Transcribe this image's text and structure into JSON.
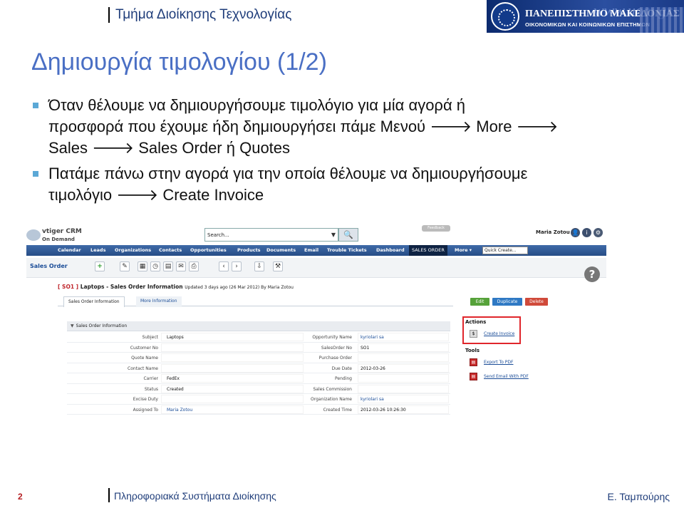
{
  "header": {
    "dept_title": "Τμήμα Διοίκησης Τεχνολογίας",
    "banner": {
      "url": "www.uom.gr",
      "university": "ΠΑΝΕΠΙΣΤΗΜΙΟ ΜΑΚΕΔΟΝΙΑΣ",
      "subtitle": "ΟΙΚΟΝΟΜΙΚΩΝ ΚΑΙ ΚΟΙΝΩΝΙΚΩΝ ΕΠΙΣΤΗΜΩΝ"
    }
  },
  "slide": {
    "title": "Δημιουργία τιμολογίου (1/2)",
    "bullets": [
      {
        "lines": [
          "Όταν θέλουμε να δημιουργήσουμε τιμολόγιο για μία αγορά ή",
          "προσφορά που έχουμε ήδη δημιουργήσει πάμε Μενού 🡒 More 🡒",
          "Sales 🡒 Sales Order ή Quotes"
        ]
      },
      {
        "lines": [
          "Πατάμε πάνω στην αγορά για την οποία θέλουμε να δημιουργήσουμε",
          "τιμολόγιο 🡒 Create Invoice"
        ]
      }
    ]
  },
  "crm": {
    "logo_line1": "vtiger CRM",
    "logo_line2": "On Demand",
    "search_placeholder": "Search...",
    "search_icon": "magnifier-icon",
    "feedback_label": "Feedback",
    "user_name": "Maria Zotou",
    "nav": [
      "Calendar",
      "Leads",
      "Organizations",
      "Contacts",
      "Opportunities",
      "Products",
      "Documents",
      "Email",
      "Trouble Tickets",
      "Dashboard",
      "SALES ORDER",
      "More ▾"
    ],
    "quick_create": "Quick Create...",
    "module_title": "Sales Order",
    "help_icon": "?",
    "record_id": "[ SO1 ]",
    "record_title": "Laptops - Sales Order Information",
    "record_updated": "Updated 3 days ago (26 Mar 2012) By Maria Zotou",
    "tabs": [
      "Sales Order Information",
      "More Information"
    ],
    "buttons": {
      "edit": "Edit",
      "duplicate": "Duplicate",
      "delete": "Delete"
    },
    "section_title": "Sales Order Information",
    "fields": [
      {
        "l1": "Subject",
        "v1": "Laptops",
        "l2": "Opportunity Name",
        "v2": "kyriolari sa",
        "v2link": true
      },
      {
        "l1": "Customer No",
        "v1": "",
        "l2": "SalesOrder No",
        "v2": "SO1",
        "v2link": false
      },
      {
        "l1": "Quote Name",
        "v1": "",
        "l2": "Purchase Order",
        "v2": "",
        "v2link": false
      },
      {
        "l1": "Contact Name",
        "v1": "",
        "l2": "Due Date",
        "v2": "2012-03-26",
        "v2link": false
      },
      {
        "l1": "Carrier",
        "v1": "FedEx",
        "l2": "Pending",
        "v2": "",
        "v2link": false
      },
      {
        "l1": "Status",
        "v1": "Created",
        "l2": "Sales Commission",
        "v2": "",
        "v2link": false
      },
      {
        "l1": "Excise Duty",
        "v1": "",
        "l2": "Organization Name",
        "v2": "kyriolari sa",
        "v2link": true
      },
      {
        "l1": "Assigned To",
        "v1": "Maria Zotou",
        "l2": "Created Time",
        "v2": "2012-03-26 10:26:30",
        "v2link": false,
        "v1link": true
      }
    ],
    "actions_title": "Actions",
    "create_invoice": "Create Invoice",
    "tools_title": "Tools",
    "export_pdf": "Export To PDF",
    "send_email_pdf": "Send Email With PDF"
  },
  "footer": {
    "page_number": "2",
    "course": "Πληροφοριακά Συστήματα Διοίκησης",
    "author": "Ε. Ταμπούρης"
  },
  "colors": {
    "title_blue": "#4a6fc4",
    "nav_blue": "#2f5894",
    "bullet": "#5ba8d6",
    "highlight_red": "#e0262b",
    "page_num": "#b51f24"
  }
}
